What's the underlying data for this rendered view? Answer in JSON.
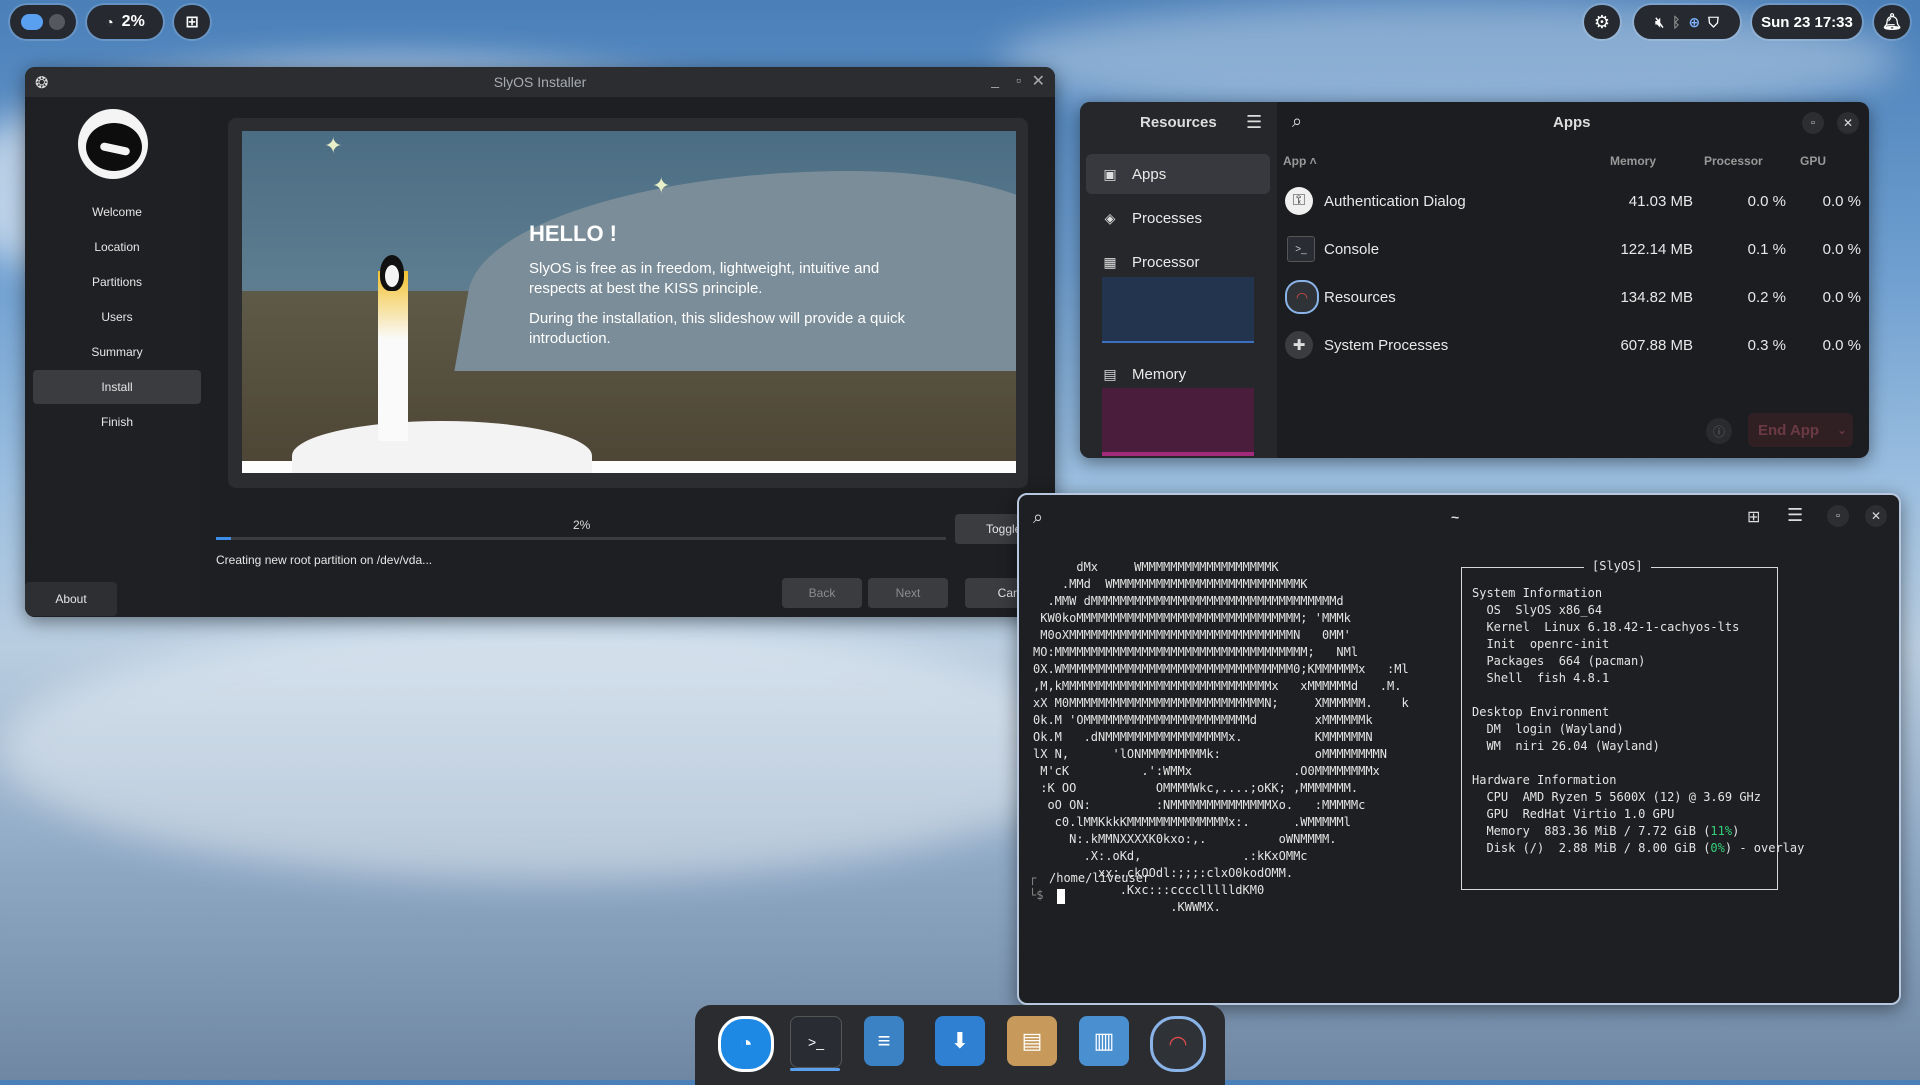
{
  "topbar": {
    "cpu_percent": "2%",
    "clock": "Sun 23 17:33"
  },
  "installer": {
    "title": "SlyOS Installer",
    "steps": [
      "Welcome",
      "Location",
      "Partitions",
      "Users",
      "Summary",
      "Install",
      "Finish"
    ],
    "active_step": "Install",
    "about_label": "About",
    "slide": {
      "heading": "HELLO !",
      "para1": "SlyOS is free as in freedom, lightweight, intuitive and respects at best the KISS principle.",
      "para2": "During the installation, this slideshow will provide a quick introduction."
    },
    "progress_text": "2%",
    "progress_fraction": 0.02,
    "status": "Creating new root partition on /dev/vda...",
    "toggle_log_label": "Toggle lo",
    "back_label": "Back",
    "next_label": "Next",
    "cancel_label": "Cance"
  },
  "resources": {
    "sidebar_title": "Resources",
    "header_title": "Apps",
    "nav": [
      {
        "label": "Apps",
        "icon": "apps-icon"
      },
      {
        "label": "Processes",
        "icon": "processes-icon"
      },
      {
        "label": "Processor",
        "icon": "processor-icon"
      },
      {
        "label": "Memory",
        "icon": "memory-icon"
      }
    ],
    "columns": {
      "app": "App",
      "memory": "Memory",
      "processor": "Processor",
      "gpu": "GPU"
    },
    "apps": [
      {
        "name": "Authentication Dialog",
        "memory": "41.03 MB",
        "processor": "0.0 %",
        "gpu": "0.0 %",
        "icon": "key-icon"
      },
      {
        "name": "Console",
        "memory": "122.14 MB",
        "processor": "0.1 %",
        "gpu": "0.0 %",
        "icon": "console-icon"
      },
      {
        "name": "Resources",
        "memory": "134.82 MB",
        "processor": "0.2 %",
        "gpu": "0.0 %",
        "icon": "gauge-icon"
      },
      {
        "name": "System Processes",
        "memory": "607.88 MB",
        "processor": "0.3 %",
        "gpu": "0.0 %",
        "icon": "puzzle-icon"
      }
    ],
    "end_app_label": "End App"
  },
  "terminal": {
    "title": "~",
    "logo_lines": [
      "      dMx     WMMMMMMMMMMMMMMMMMMK",
      "    .MMd  WMMMMMMMMMMMMMMMMMMMMMMMMMMK",
      "  .MMW dMMMMMMMMMMMMMMMMMMMMMMMMMMMMMMMMMMd",
      " KW0koMMMMMMMMMMMMMMMMMMMMMMMMMMMMMMM; 'MMMk",
      " M0oXMMMMMMMMMMMMMMMMMMMMMMMMMMMMMMMN   0MM'",
      "MO:MMMMMMMMMMMMMMMMMMMMMMMMMMMMMMMMMMM;   NMl",
      "0X.WMMMMMMMMMMMMMMMMMMMMMMMMMMMMMMMM0;KMMMMMMx   :Ml",
      ",M,kMMMMMMMMMMMMMMMMMMMMMMMMMMMMMx   xMMMMMMd   .M.",
      "xX M0MMMMMMMMMMMMMMMMMMMMMMMMMMMN;     XMMMMMM.    k",
      "0k.M 'OMMMMMMMMMMMMMMMMMMMMMMMd        xMMMMMMk",
      "Ok.M   .dNMMMMMMMMMMMMMMMMMx.          KMMMMMMN",
      "lX N,      'lONMMMMMMMMMk:             oMMMMMMMMN",
      " M'cK          .':WMMx              .O0MMMMMMMMx",
      " :K OO           OMMMMWkc,....;oKK; ,MMMMMMM.",
      "  oO ON:         :NMMMMMMMMMMMMMMXo.   :MMMMMc",
      "   c0.lMMKkkKMMMMMMMMMMMMMMx:.      .WMMMMMl",
      "     N:.kMMNXXXXK0kxo:,.          oWNMMMM.",
      "       .X:.oKd,              .:kKxOMMc",
      "         xx;,ckOOdl:;;;:clxO0kodOMM.",
      "            .Kxc:::ccccllllldKM0",
      "                   .KWWMX."
    ],
    "box_title": "[SlyOS]",
    "sys_heading": "System Information",
    "sys_lines": [
      {
        "k": "OS",
        "v": "SlyOS x86_64"
      },
      {
        "k": "Kernel",
        "v": "Linux 6.18.42-1-cachyos-lts"
      },
      {
        "k": "Init",
        "v": "openrc-init"
      },
      {
        "k": "Packages",
        "v": "664 (pacman)"
      },
      {
        "k": "Shell",
        "v": "fish 4.8.1"
      }
    ],
    "de_heading": "Desktop Environment",
    "de_lines": [
      {
        "k": "DM",
        "v": "login (Wayland)"
      },
      {
        "k": "WM",
        "v": "niri 26.04 (Wayland)"
      }
    ],
    "hw_heading": "Hardware Information",
    "cpu": "CPU  AMD Ryzen 5 5600X (12) @ 3.69 GHz",
    "gpu": "GPU  RedHat Virtio 1.0 GPU",
    "mem_prefix": "Memory  883.36 MiB / 7.72 GiB (",
    "mem_pct": "11%",
    "mem_suffix": ")",
    "disk_prefix": "Disk (/)  2.88 MiB / 8.00 GiB (",
    "disk_pct": "0%",
    "disk_suffix": ") - overlay",
    "cwd": "/home/liveuser",
    "prompt": "$"
  },
  "dock": [
    {
      "name": "browser-icon",
      "color": "#1e88e5"
    },
    {
      "name": "terminal-icon",
      "color": "#2a2c34"
    },
    {
      "name": "text-editor-icon",
      "color": "#3b82c4"
    },
    {
      "name": "installer-icon",
      "color": "#2f7fd2"
    },
    {
      "name": "package-icon",
      "color": "#c79a5b"
    },
    {
      "name": "file-manager-icon",
      "color": "#4a90d0"
    },
    {
      "name": "resources-monitor-icon",
      "color": "#2f3338"
    }
  ],
  "colors": {
    "accent_green": "#33d17a",
    "resources_cpu_graph": "#2a4a73",
    "resources_mem_graph": "#7a2a5c"
  }
}
